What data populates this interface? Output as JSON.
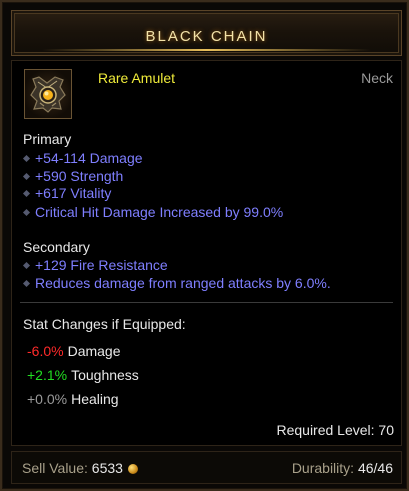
{
  "item": {
    "name": "BLACK CHAIN",
    "type": "Rare Amulet",
    "slot": "Neck",
    "icon": "amulet-icon"
  },
  "primary": {
    "label": "Primary",
    "affixes": [
      "+54-114 Damage",
      "+590 Strength",
      "+617 Vitality",
      "Critical Hit Damage Increased by 99.0%"
    ]
  },
  "secondary": {
    "label": "Secondary",
    "affixes": [
      "+129 Fire Resistance",
      "Reduces damage from ranged attacks by 6.0%."
    ]
  },
  "stat_changes": {
    "header": "Stat Changes if Equipped:",
    "rows": [
      {
        "value": "-6.0%",
        "label": "Damage",
        "color": "#ff2a2a"
      },
      {
        "value": "+2.1%",
        "label": "Toughness",
        "color": "#22dd22"
      },
      {
        "value": "+0.0%",
        "label": "Healing",
        "color": "#9a9a9a"
      }
    ]
  },
  "required_level": {
    "label": "Required Level:",
    "value": "70"
  },
  "footer": {
    "sell_label": "Sell Value:",
    "sell_value": "6533",
    "sell_icon": "gold-coin-icon",
    "durability_label": "Durability:",
    "durability_value": "46/46"
  },
  "colors": {
    "rare": "#f0ec3a",
    "affix": "#7f7fff",
    "title": "#f2e2a8"
  }
}
